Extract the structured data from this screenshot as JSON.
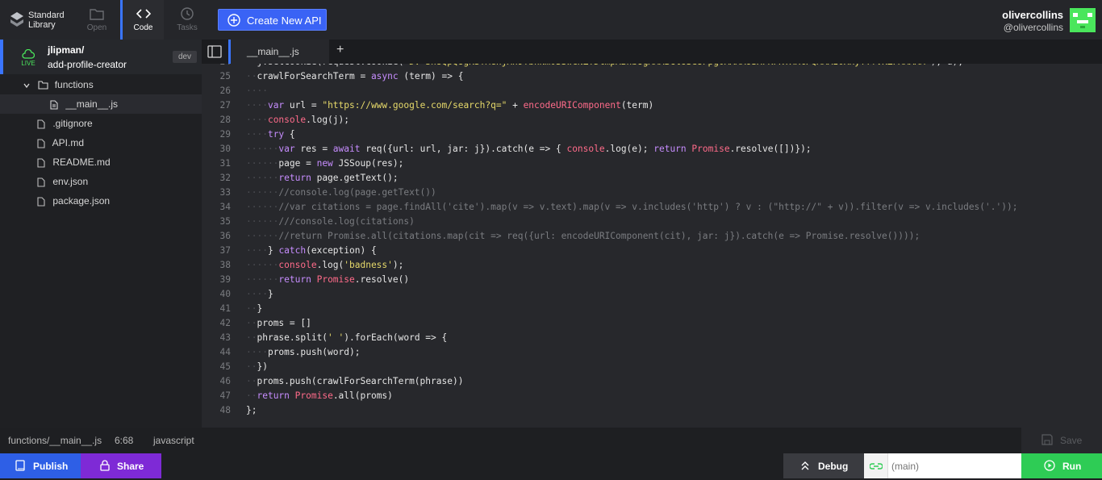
{
  "header": {
    "logo_line1": "Standard",
    "logo_line2": "Library",
    "nav": {
      "open": "Open",
      "code": "Code",
      "tasks": "Tasks"
    },
    "create_label": "Create New API",
    "user_name": "olivercollins",
    "user_handle": "@olivercollins"
  },
  "sidebar": {
    "live_label": "LIVE",
    "owner": "jlipman/",
    "repo": "add-profile-creator",
    "env_badge": "dev",
    "folder": "functions",
    "active_file": "__main__.js",
    "files": [
      ".gitignore",
      "API.md",
      "README.md",
      "env.json",
      "package.json"
    ]
  },
  "editor": {
    "tab": "__main__.js",
    "add_tab": "+"
  },
  "status": {
    "path": "functions/__main__.js",
    "position": "6:68",
    "language": "javascript",
    "save_label": "Save"
  },
  "bottom": {
    "publish": "Publish",
    "share": "Share",
    "debug": "Debug",
    "url_placeholder": "(main)",
    "run": "Run"
  },
  "colors": {
    "accent": "#3a63f5",
    "live": "#4ae65c",
    "share": "#7e2ad6",
    "run": "#2ecc55"
  }
}
